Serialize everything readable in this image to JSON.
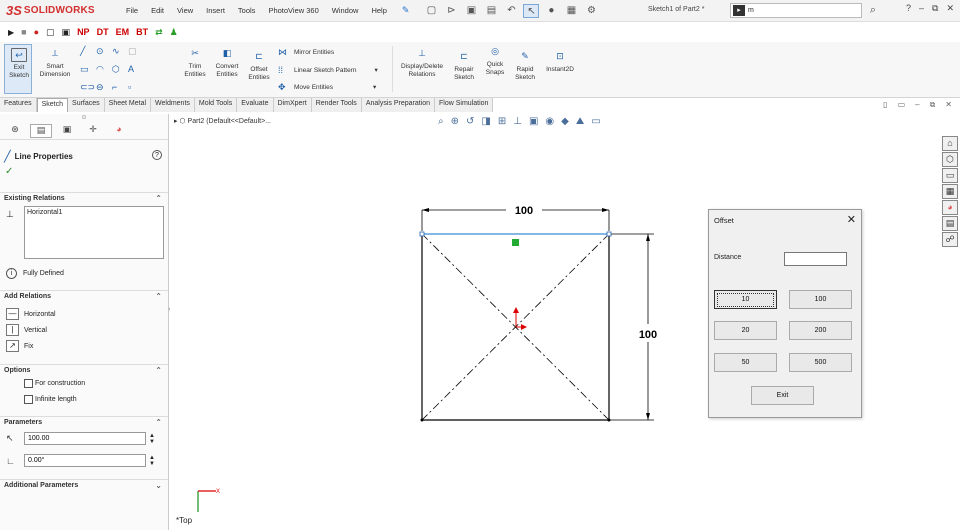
{
  "app": {
    "logo_mark": "3S",
    "logo_text": "SOLIDWORKS",
    "doc_title": "Sketch1 of Part2 *"
  },
  "menu": [
    "File",
    "Edit",
    "View",
    "Insert",
    "Tools",
    "PhotoView 360",
    "Window",
    "Help"
  ],
  "search": {
    "cmd": "m",
    "value": "m"
  },
  "quickbar": [
    "NP",
    "DT",
    "EM",
    "BT"
  ],
  "ribbon": {
    "exit_sketch": "Exit Sketch",
    "smart_dimension": "Smart Dimension",
    "trim_entities": "Trim Entities",
    "convert_entities": "Convert Entities",
    "offset_entities": "Offset Entities",
    "mirror_entities": "Mirror Entities",
    "linear_sketch_pattern": "Linear Sketch Pattern",
    "move_entities": "Move Entities",
    "display_delete_relations": "Display/Delete Relations",
    "repair_sketch": "Repair Sketch",
    "quick_snaps": "Quick Snaps",
    "rapid_sketch": "Rapid Sketch",
    "instant2d": "Instant2D"
  },
  "tabs": [
    "Features",
    "Sketch",
    "Surfaces",
    "Sheet Metal",
    "Weldments",
    "Mold Tools",
    "Evaluate",
    "DimXpert",
    "Render Tools",
    "Analysis Preparation",
    "Flow Simulation"
  ],
  "active_tab": "Sketch",
  "panel": {
    "title": "Line Properties",
    "existing_relations_header": "Existing Relations",
    "existing_relations": [
      "Horizontal1"
    ],
    "status": "Fully Defined",
    "add_relations_header": "Add Relations",
    "add_relations": [
      "Horizontal",
      "Vertical",
      "Fix"
    ],
    "options_header": "Options",
    "options": [
      "For construction",
      "Infinite length"
    ],
    "parameters_header": "Parameters",
    "length": "100.00",
    "angle": "0.00°",
    "additional_header": "Additional Parameters"
  },
  "canvas": {
    "breadcrumb": "Part2  (Default<<Default>...",
    "dim_top": "100",
    "dim_right": "100",
    "view_label": "*Top"
  },
  "dialog": {
    "title": "Offset",
    "distance_label": "Distance",
    "distance_value": "",
    "buttons": [
      "10",
      "100",
      "20",
      "200",
      "50",
      "500"
    ],
    "exit": "Exit"
  },
  "colors": {
    "accent": "#1f5fa8",
    "brand": "#d32f2f",
    "selected_line": "#3a8fd8",
    "handle": "#22aa33"
  }
}
